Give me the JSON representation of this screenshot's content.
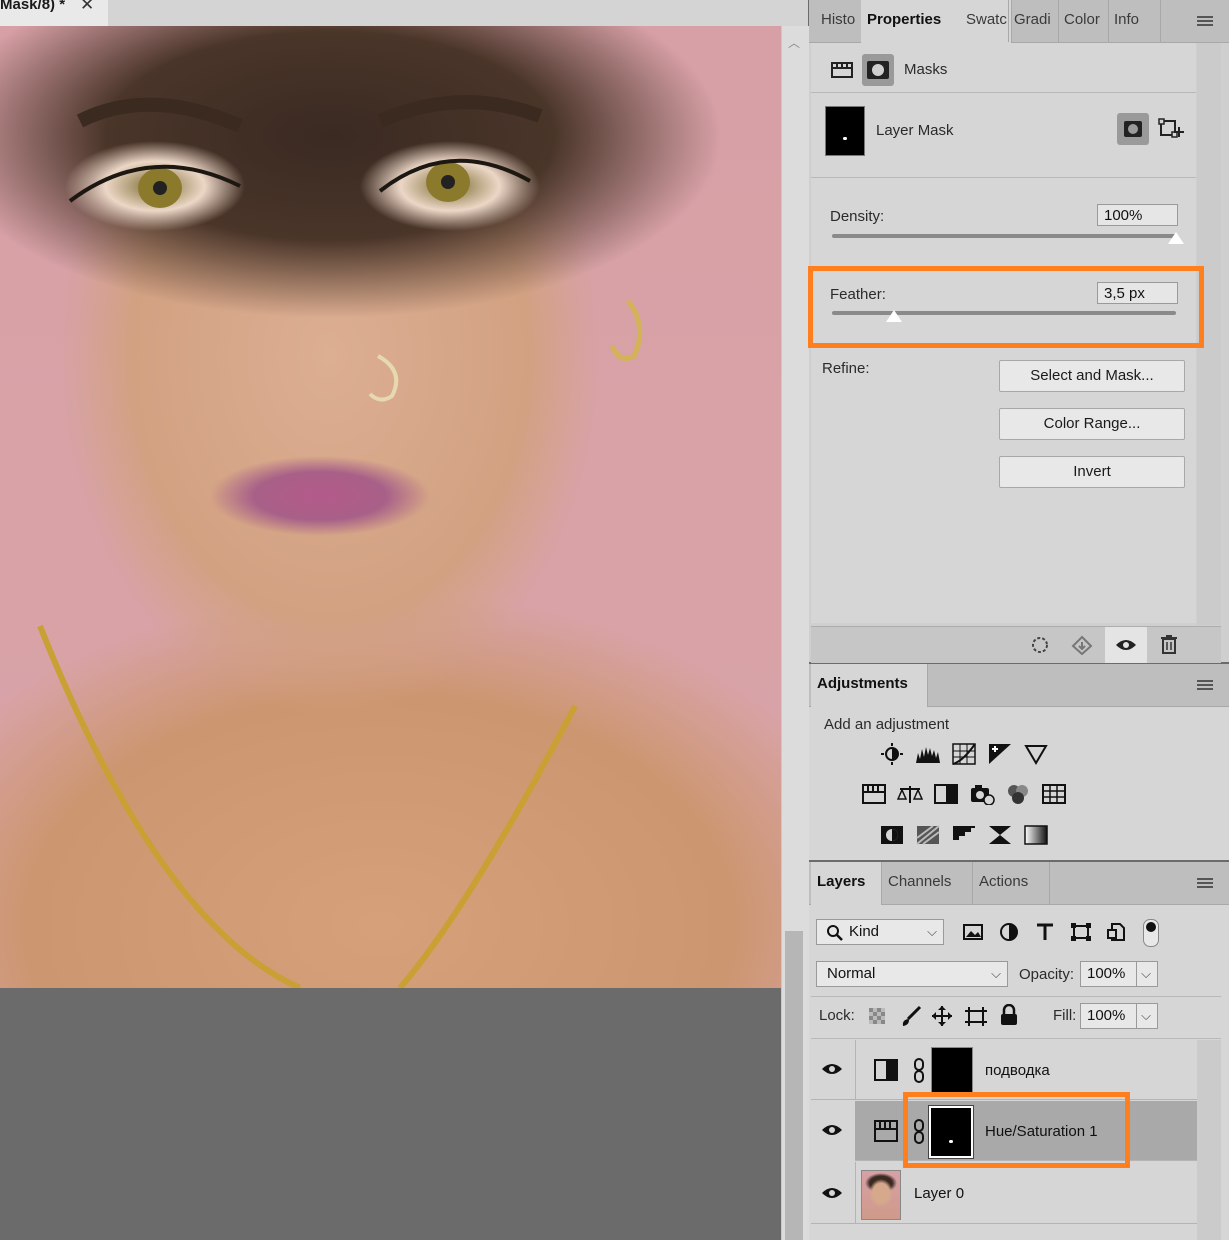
{
  "document": {
    "tab_title": "Mask/8) *",
    "close_glyph": "✕",
    "scroll_up_glyph": "︿"
  },
  "properties_panel": {
    "tabs": [
      "Histo",
      "Properties",
      "Swatc",
      "Gradi",
      "Color",
      "Info"
    ],
    "active_tab": "Properties",
    "section_title": "Masks",
    "mask_label": "Layer Mask",
    "density_label": "Density:",
    "density_value": "100%",
    "density_level_percent": 100,
    "feather_label": "Feather:",
    "feather_value": "3,5 px",
    "feather_level_fraction": 0.18,
    "refine_label": "Refine:",
    "buttons": {
      "select_and_mask": "Select and Mask...",
      "color_range": "Color Range...",
      "invert": "Invert"
    }
  },
  "adjustments_panel": {
    "tab": "Adjustments",
    "subtitle": "Add an adjustment"
  },
  "layers_panel": {
    "tabs": [
      "Layers",
      "Channels",
      "Actions"
    ],
    "active_tab": "Layers",
    "filter_kind": "Kind",
    "blend_mode": "Normal",
    "opacity_label": "Opacity:",
    "opacity_value": "100%",
    "lock_label": "Lock:",
    "fill_label": "Fill:",
    "fill_value": "100%",
    "layers": [
      {
        "name": "подводка",
        "type": "adjustment"
      },
      {
        "name": "Hue/Saturation 1",
        "type": "adjustment",
        "selected": true
      },
      {
        "name": "Layer 0",
        "type": "pixel"
      }
    ]
  },
  "colors": {
    "highlight": "#ff7f1e",
    "panel": "#d6d6d6"
  }
}
